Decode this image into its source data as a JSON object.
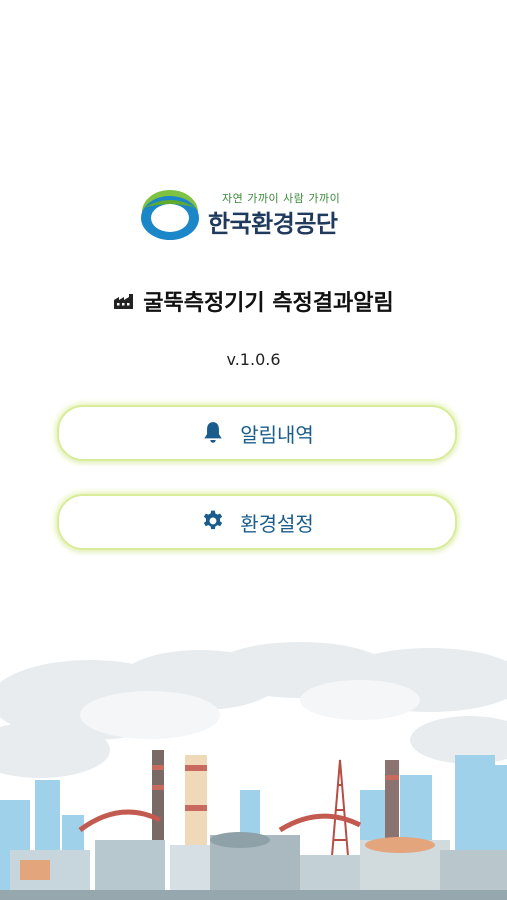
{
  "logo": {
    "slogan": "자연 가까이 사람 가까이",
    "name": "한국환경공단"
  },
  "header": {
    "title": "굴뚝측정기기 측정결과알림",
    "version": "v.1.0.6"
  },
  "menu": {
    "alarm_label": "알림내역",
    "settings_label": "환경설정"
  },
  "colors": {
    "button_text": "#1a5d8c",
    "button_border": "#d8ec9a",
    "icon": "#1a5d8c"
  },
  "icons": {
    "title": "factory-icon",
    "alarm": "bell-icon",
    "settings": "gear-icon"
  }
}
